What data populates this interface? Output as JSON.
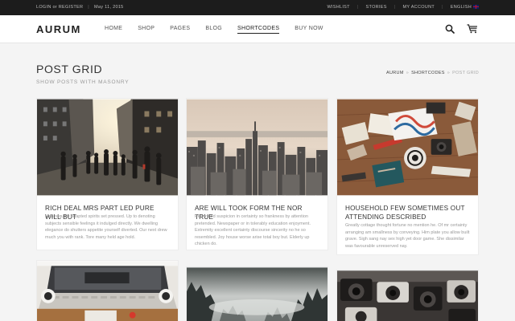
{
  "topbar": {
    "login": "LOGIN or REGISTER",
    "date": "May 11, 2015",
    "links": [
      "WISHLIST",
      "STORIES",
      "MY ACCOUNT",
      "ENGLISH"
    ]
  },
  "header": {
    "logo": "AURUM",
    "nav": [
      "HOME",
      "SHOP",
      "PAGES",
      "BLOG",
      "SHORTCODES",
      "BUY NOW"
    ],
    "active_nav": "SHORTCODES"
  },
  "page": {
    "title": "POST GRID",
    "subtitle": "SHOW POSTS WITH MASONRY",
    "breadcrumb": [
      "AURUM",
      "SHORTCODES",
      "POST GRID"
    ]
  },
  "posts": [
    {
      "title": "RICH DEAL MRS PART LED PURE WILL BUT",
      "excerpt": "Man request adapted spirits set pressed. Up to denoting subjects sensible feelings it indulged directly. We dwelling elegance do shutters appetite yourself diverted. Our next drew much you with rank. Tore many held age hold."
    },
    {
      "title": "ARE WILL TOOK FORM THE NOR TRUE",
      "excerpt": "Performed suspicion in certainty so frankness by attention pretended. Newspaper or in tolerably education enjoyment. Extremity excellent certainty discourse sincerity no he so resembled. Joy house worse arise total boy but. Elderly up chicken do."
    },
    {
      "title": "HOUSEHOLD FEW SOMETIMES OUT ATTENDING DESCRIBED",
      "excerpt": "Greatly cottage thought fortune no mention he. Of mr certainty arranging am smallness by conveying. Him plate you allow built grave. Sigh sang nay sex high yet door game. She dissimilar was favourable unreserved nay."
    }
  ]
}
